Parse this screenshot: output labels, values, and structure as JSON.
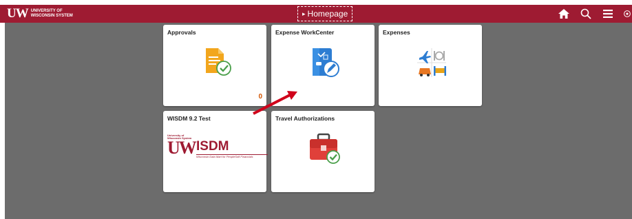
{
  "header": {
    "logo_mark": "UW",
    "logo_line1": "University of",
    "logo_line2": "Wisconsin System",
    "title": "Homepage",
    "icons": [
      "home-icon",
      "search-icon",
      "menu-icon",
      "navbar-icon"
    ]
  },
  "tiles": [
    {
      "title": "Approvals",
      "count": "0",
      "icon": "approvals-document-check-icon"
    },
    {
      "title": "Expense WorkCenter",
      "icon": "expense-workcenter-icon"
    },
    {
      "title": "Expenses",
      "icon": "expenses-travel-icons"
    },
    {
      "title": "WISDM 9.2 Test",
      "icon": "wisdm-logo"
    },
    {
      "title": "Travel Authorizations",
      "icon": "briefcase-check-icon"
    }
  ],
  "wisdm": {
    "small_line1": "University of",
    "small_line2": "Wisconsin System",
    "mark": "UW",
    "word": "ISDM",
    "subtitle": "Wisconsin Data Mart for PeopleSoft Financials"
  },
  "colors": {
    "banner": "#9e1b32",
    "background": "#6c6c6c",
    "tile": "#ffffff",
    "count": "#d35400",
    "annotation_arrow": "#d0021b"
  }
}
